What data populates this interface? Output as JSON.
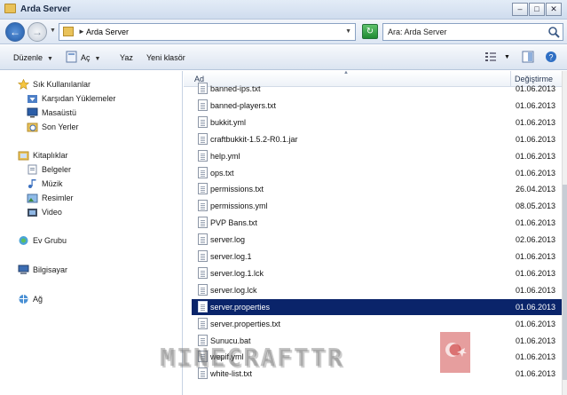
{
  "window": {
    "title": "Arda Server"
  },
  "address": {
    "path": "Arda Server",
    "search_placeholder": "Ara: Arda Server"
  },
  "toolbar": {
    "organize": "Düzenle",
    "open": "Aç",
    "print": "Yaz",
    "new_folder": "Yeni klasör"
  },
  "sidebar": {
    "items": [
      {
        "label": "Sık Kullanılanlar",
        "icon": "star-icon"
      },
      {
        "label": "Karşıdan Yüklemeler",
        "icon": "downloads-icon"
      },
      {
        "label": "Masaüstü",
        "icon": "desktop-icon"
      },
      {
        "label": "Son Yerler",
        "icon": "recent-places-icon"
      },
      {
        "label": "Kitaplıklar",
        "icon": "libraries-icon"
      },
      {
        "label": "Belgeler",
        "icon": "documents-icon"
      },
      {
        "label": "Müzik",
        "icon": "music-icon"
      },
      {
        "label": "Resimler",
        "icon": "pictures-icon"
      },
      {
        "label": "Video",
        "icon": "video-icon"
      },
      {
        "label": "Ev Grubu",
        "icon": "homegroup-icon"
      },
      {
        "label": "Bilgisayar",
        "icon": "computer-icon"
      },
      {
        "label": "Ağ",
        "icon": "network-icon"
      }
    ]
  },
  "list": {
    "columns": {
      "name": "Ad",
      "date": "Değiştirme"
    },
    "files": [
      {
        "name": "banned-ips.txt",
        "date": "01.06.2013"
      },
      {
        "name": "banned-players.txt",
        "date": "01.06.2013"
      },
      {
        "name": "bukkit.yml",
        "date": "01.06.2013"
      },
      {
        "name": "craftbukkit-1.5.2-R0.1.jar",
        "date": "01.06.2013"
      },
      {
        "name": "help.yml",
        "date": "01.06.2013"
      },
      {
        "name": "ops.txt",
        "date": "01.06.2013"
      },
      {
        "name": "permissions.txt",
        "date": "26.04.2013"
      },
      {
        "name": "permissions.yml",
        "date": "08.05.2013"
      },
      {
        "name": "PVP Bans.txt",
        "date": "01.06.2013"
      },
      {
        "name": "server.log",
        "date": "02.06.2013"
      },
      {
        "name": "server.log.1",
        "date": "01.06.2013"
      },
      {
        "name": "server.log.1.lck",
        "date": "01.06.2013"
      },
      {
        "name": "server.log.lck",
        "date": "01.06.2013"
      },
      {
        "name": "server.properties",
        "date": "01.06.2013"
      },
      {
        "name": "server.properties.txt",
        "date": "01.06.2013"
      },
      {
        "name": "Sunucu.bat",
        "date": "01.06.2013"
      },
      {
        "name": "wepif.yml",
        "date": "01.06.2013"
      },
      {
        "name": "white-list.txt",
        "date": "01.06.2013"
      }
    ],
    "selected_index": 13
  },
  "watermark": {
    "text": "MINECRAFTTR"
  }
}
